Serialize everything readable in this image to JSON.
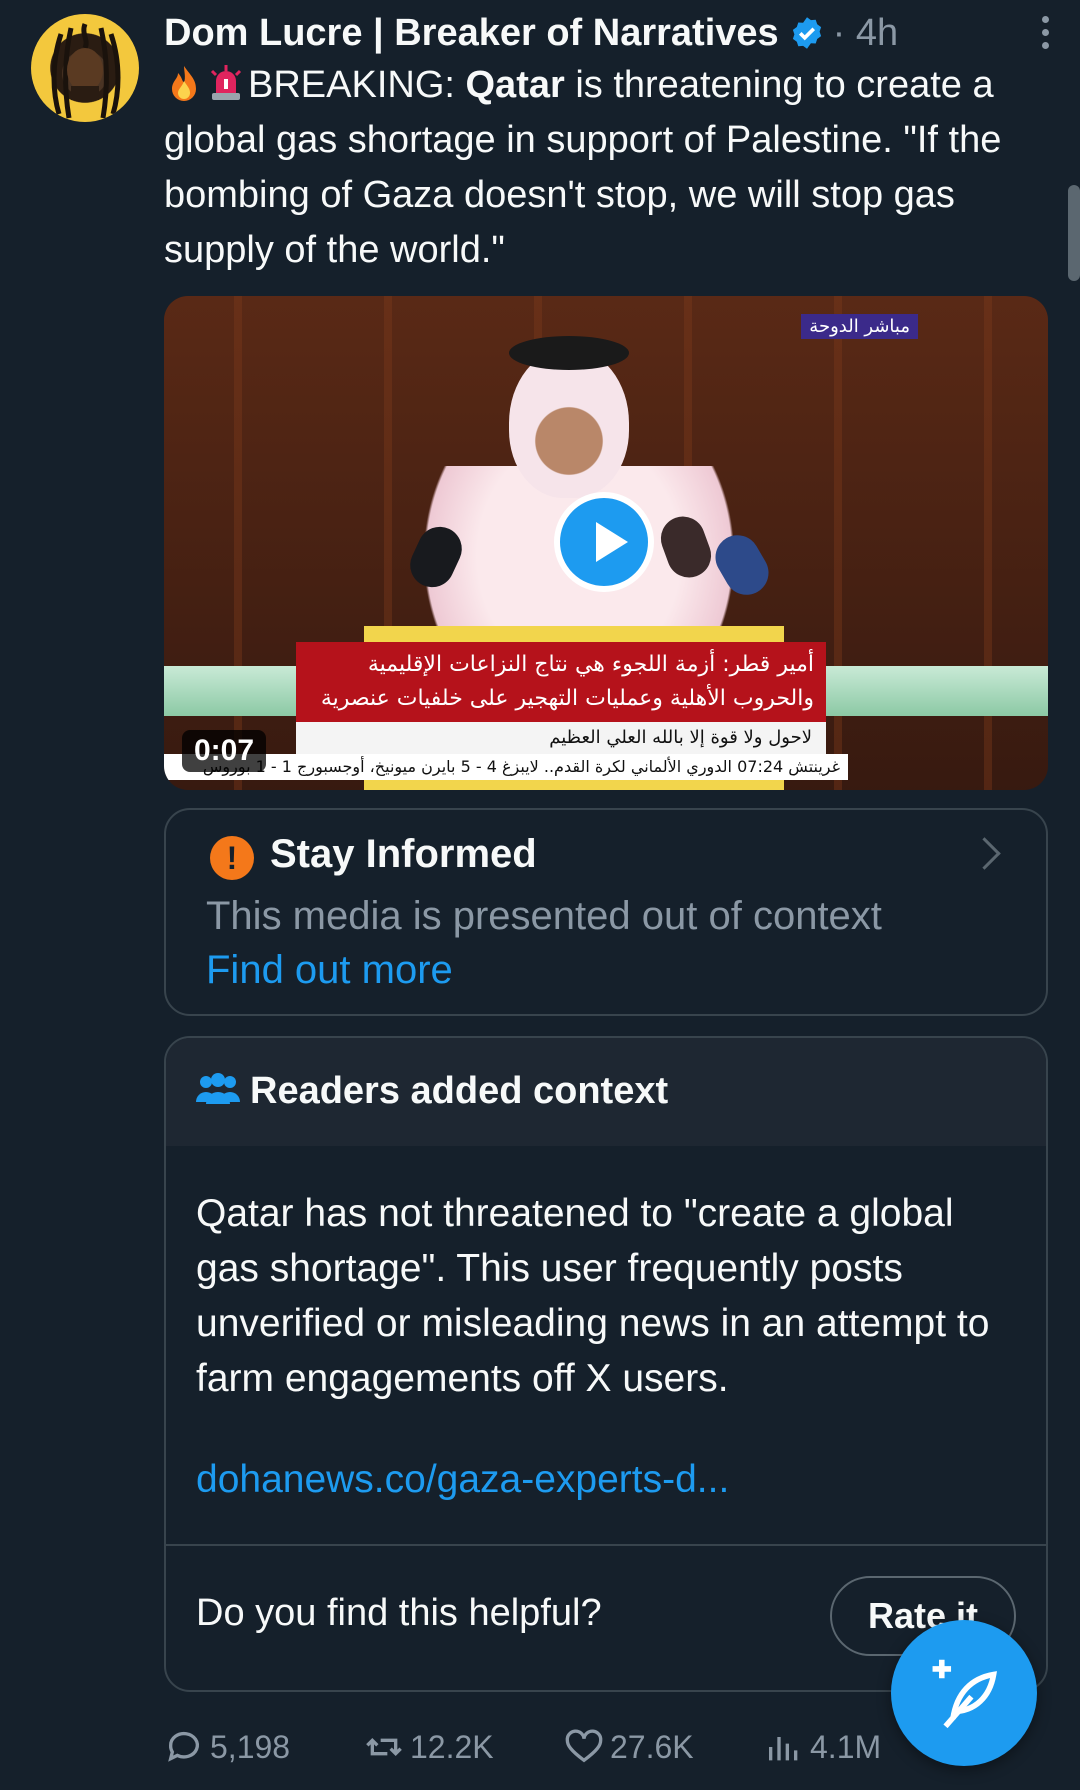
{
  "author": {
    "name": "Dom Lucre | Breaker of Narratives",
    "time": "· 4h"
  },
  "tweet": {
    "lead": "BREAKING: ",
    "bold": "Qatar",
    "rest": " is threatening to create a global gas shortage in support of Palestine. \"If the bombing of Gaza doesn't stop, we will stop gas supply of the world.\""
  },
  "video": {
    "duration": "0:07",
    "channel": "مباشر الدوحة",
    "caption_line1": "أمير قطر: أزمة اللجوء هي نتاج النزاعات الإقليمية",
    "caption_line2": "والحروب الأهلية وعمليات التهجير على خلفيات عنصرية",
    "ticker1": "لاحول ولا قوة إلا بالله العلي العظيم",
    "ticker2": "غرينتش 07:24 الدوري الألماني لكرة القدم.. لايبزغ 4 - 5 بايرن ميونيخ، أوجسبورج 1 - 1 بوروس"
  },
  "stay_informed": {
    "title": "Stay Informed",
    "description": "This media is presented out of context",
    "link": "Find out more"
  },
  "community_note": {
    "title": "Readers added context",
    "body": "Qatar has not threatened to \"create a global gas shortage\". This user frequently posts unverified or misleading news in an attempt to farm engagements off X users.",
    "link": "dohanews.co/gaza-experts-d...",
    "helpful_prompt": "Do you find this helpful?",
    "rate_label": "Rate it"
  },
  "actions": {
    "replies": "5,198",
    "reposts": "12.2K",
    "likes": "27.6K",
    "views": "4.1M"
  },
  "colors": {
    "background": "#15202b",
    "accent": "#1d9bf0",
    "muted": "#8b98a5",
    "warning": "#f4781a"
  }
}
